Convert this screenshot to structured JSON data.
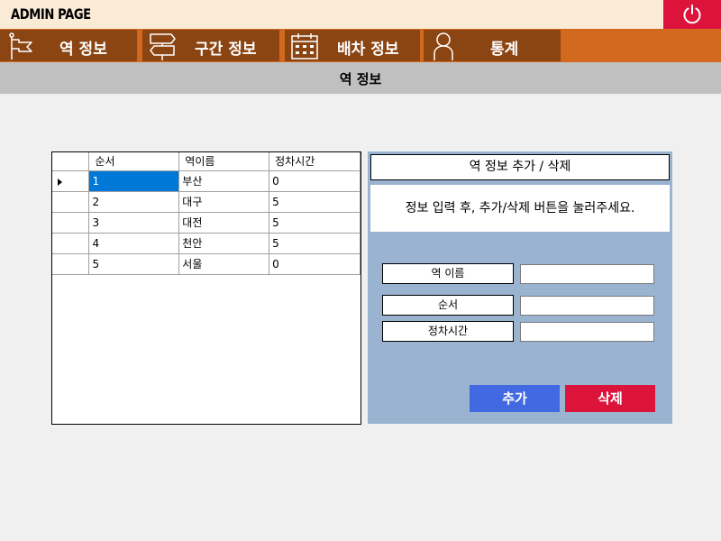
{
  "app": {
    "title": "ADMIN PAGE"
  },
  "nav": {
    "items": [
      {
        "label": "역 정보",
        "icon": "flag-icon"
      },
      {
        "label": "구간 정보",
        "icon": "signpost-icon"
      },
      {
        "label": "배차 정보",
        "icon": "calendar-icon"
      },
      {
        "label": "통계",
        "icon": "person-icon"
      }
    ]
  },
  "section": {
    "title": "역 정보"
  },
  "grid": {
    "columns": [
      "순서",
      "역이름",
      "정차시간"
    ],
    "rows": [
      [
        "1",
        "부산",
        "0"
      ],
      [
        "2",
        "대구",
        "5"
      ],
      [
        "3",
        "대전",
        "5"
      ],
      [
        "4",
        "천안",
        "5"
      ],
      [
        "5",
        "서울",
        "0"
      ]
    ],
    "selected_row": 0
  },
  "panel": {
    "title": "역 정보 추가 / 삭제",
    "message": "정보 입력 후, 추가/삭제 버튼을 눌러주세요.",
    "fields": [
      {
        "label": "역 이름",
        "value": ""
      },
      {
        "label": "순서",
        "value": ""
      },
      {
        "label": "정차시간",
        "value": ""
      }
    ],
    "add_label": "추가",
    "delete_label": "삭제"
  },
  "colors": {
    "title_bar": "#faebd7",
    "nav_bar": "#d2691e",
    "nav_item": "#8b4513",
    "power_button": "#dc143c",
    "section_bar": "#c0c0c0",
    "panel": "#9ab3d0",
    "add_button": "#4169e1",
    "delete_button": "#dc143c",
    "selected_cell": "#0078d7"
  }
}
